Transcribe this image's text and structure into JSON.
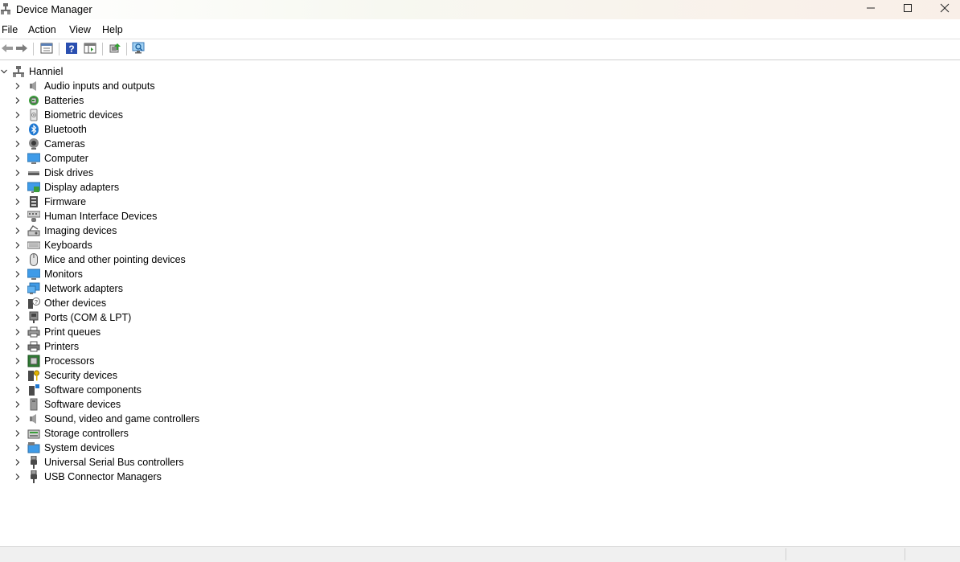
{
  "window": {
    "title": "Device Manager"
  },
  "menu": {
    "file": "File",
    "action": "Action",
    "view": "View",
    "help": "Help"
  },
  "toolbar": {
    "buttons": [
      "back-icon",
      "forward-icon",
      "properties-icon",
      "help-icon",
      "show-hide-console-tree-icon",
      "update-driver-icon",
      "scan-hardware-icon"
    ]
  },
  "tree": {
    "root": {
      "label": "Hanniel",
      "expanded": true,
      "icon": "computer-network-icon"
    },
    "items": [
      {
        "label": "Audio inputs and outputs",
        "icon": "speaker-icon"
      },
      {
        "label": "Batteries",
        "icon": "battery-icon"
      },
      {
        "label": "Biometric devices",
        "icon": "fingerprint-icon"
      },
      {
        "label": "Bluetooth",
        "icon": "bluetooth-icon"
      },
      {
        "label": "Cameras",
        "icon": "camera-icon"
      },
      {
        "label": "Computer",
        "icon": "monitor-icon"
      },
      {
        "label": "Disk drives",
        "icon": "disk-drive-icon"
      },
      {
        "label": "Display adapters",
        "icon": "display-adapter-icon"
      },
      {
        "label": "Firmware",
        "icon": "firmware-icon"
      },
      {
        "label": "Human Interface Devices",
        "icon": "hid-icon"
      },
      {
        "label": "Imaging devices",
        "icon": "imaging-icon"
      },
      {
        "label": "Keyboards",
        "icon": "keyboard-icon"
      },
      {
        "label": "Mice and other pointing devices",
        "icon": "mouse-icon"
      },
      {
        "label": "Monitors",
        "icon": "monitor-icon"
      },
      {
        "label": "Network adapters",
        "icon": "network-adapter-icon"
      },
      {
        "label": "Other devices",
        "icon": "unknown-device-icon"
      },
      {
        "label": "Ports (COM & LPT)",
        "icon": "port-icon"
      },
      {
        "label": "Print queues",
        "icon": "printer-icon"
      },
      {
        "label": "Printers",
        "icon": "printer-icon"
      },
      {
        "label": "Processors",
        "icon": "processor-icon"
      },
      {
        "label": "Security devices",
        "icon": "security-key-icon"
      },
      {
        "label": "Software components",
        "icon": "software-component-icon"
      },
      {
        "label": "Software devices",
        "icon": "software-device-icon"
      },
      {
        "label": "Sound, video and game controllers",
        "icon": "speaker-icon"
      },
      {
        "label": "Storage controllers",
        "icon": "storage-controller-icon"
      },
      {
        "label": "System devices",
        "icon": "system-device-icon"
      },
      {
        "label": "Universal Serial Bus controllers",
        "icon": "usb-icon"
      },
      {
        "label": "USB Connector Managers",
        "icon": "usb-icon"
      }
    ]
  }
}
